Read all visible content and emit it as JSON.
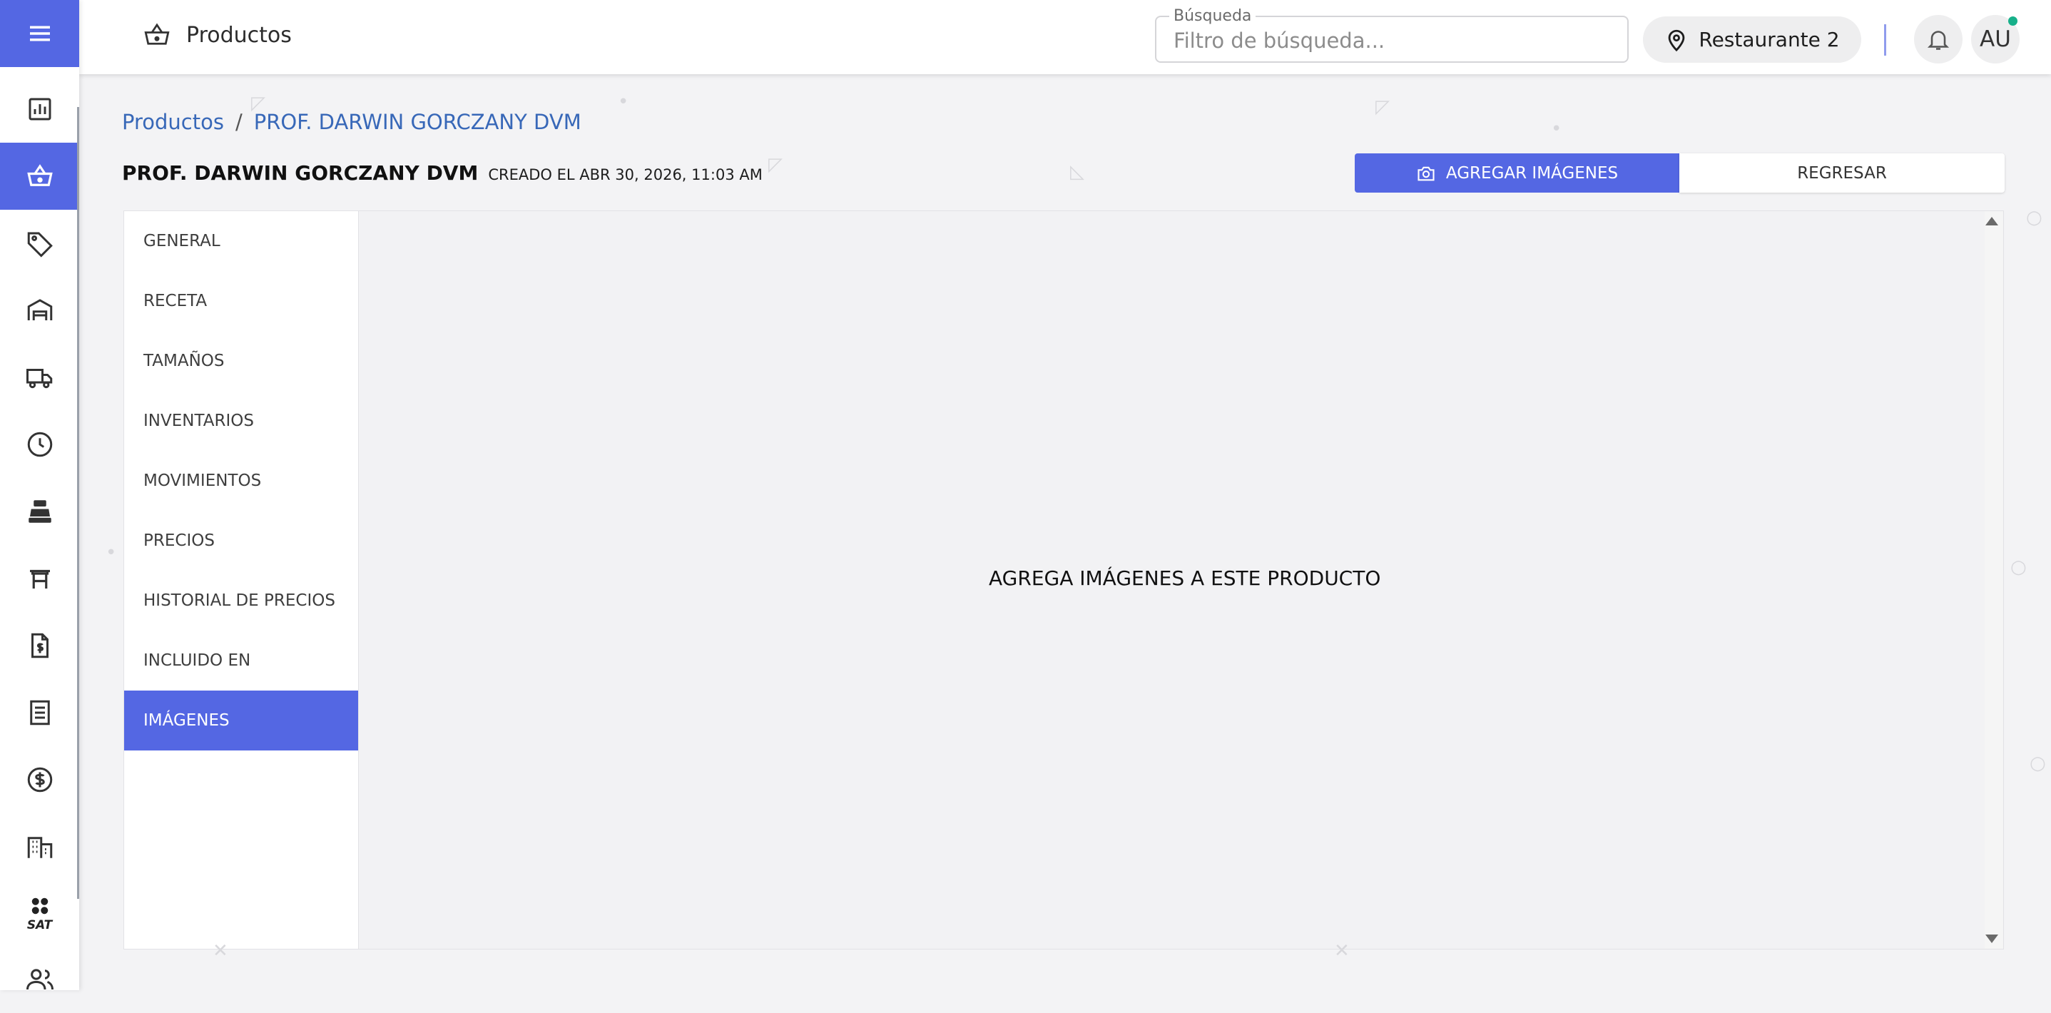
{
  "topbar": {
    "title": "Productos",
    "search_legend": "Búsqueda",
    "search_placeholder": "Filtro de búsqueda...",
    "location_label": "Restaurante 2",
    "avatar_initials": "AU"
  },
  "sidebar": {
    "items": [
      {
        "icon": "chart-icon"
      },
      {
        "icon": "basket-icon",
        "active": true
      },
      {
        "icon": "tag-icon"
      },
      {
        "icon": "warehouse-icon"
      },
      {
        "icon": "truck-icon"
      },
      {
        "icon": "clock-icon"
      },
      {
        "icon": "cash-register-icon"
      },
      {
        "icon": "table-icon"
      },
      {
        "icon": "invoice-icon"
      },
      {
        "icon": "receipt-icon"
      },
      {
        "icon": "dollar-icon"
      },
      {
        "icon": "building-icon"
      },
      {
        "icon": "sat-icon",
        "label": "SAT"
      },
      {
        "icon": "users-icon"
      }
    ]
  },
  "breadcrumb": {
    "root": "Productos",
    "separator": "/",
    "current": "PROF. DARWIN GORCZANY DVM"
  },
  "product": {
    "name": "PROF. DARWIN GORCZANY DVM",
    "created": "CREADO EL ABR 30, 2026, 11:03 AM"
  },
  "actions": {
    "add_images": "AGREGAR IMÁGENES",
    "back": "REGRESAR"
  },
  "tabs": [
    {
      "label": "GENERAL"
    },
    {
      "label": "RECETA"
    },
    {
      "label": "TAMAÑOS"
    },
    {
      "label": "INVENTARIOS"
    },
    {
      "label": "MOVIMIENTOS"
    },
    {
      "label": "PRECIOS"
    },
    {
      "label": "HISTORIAL DE PRECIOS"
    },
    {
      "label": "INCLUIDO EN"
    },
    {
      "label": "IMÁGENES",
      "active": true
    }
  ],
  "empty_message": "AGREGA IMÁGENES A ESTE PRODUCTO",
  "colors": {
    "accent": "#5467e3",
    "link": "#3868b8",
    "status_dot": "#17b08a"
  }
}
